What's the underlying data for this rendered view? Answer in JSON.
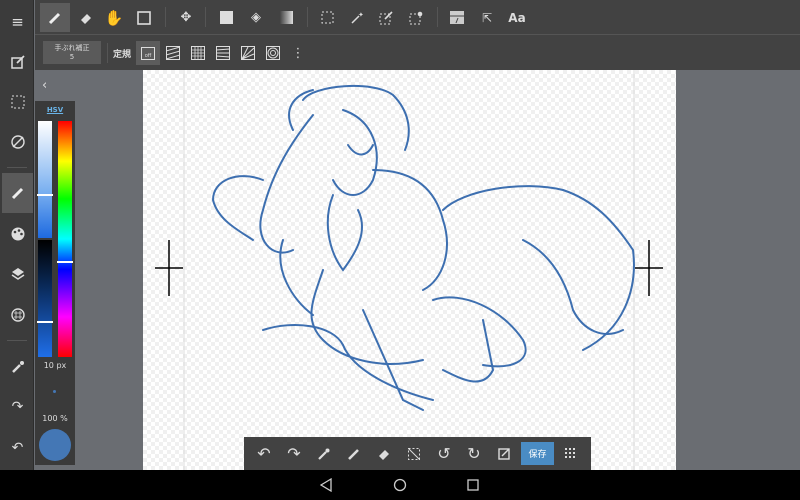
{
  "toolbar": {
    "stabilizer_label": "手ぶれ補正",
    "stabilizer_value": "5",
    "ruler_label": "定規",
    "ruler_off": "off",
    "text_tool": "Aa"
  },
  "color_panel": {
    "mode": "HSV",
    "brush_size": "10 px",
    "opacity": "100 %",
    "current_color": "#4477b5",
    "value_fraction": 0.37,
    "hue_fraction": 0.6
  },
  "bottom_bar": {
    "save_label": "保存"
  },
  "colors": {
    "accent": "#4a90c8",
    "stroke": "#3d6fb0"
  }
}
